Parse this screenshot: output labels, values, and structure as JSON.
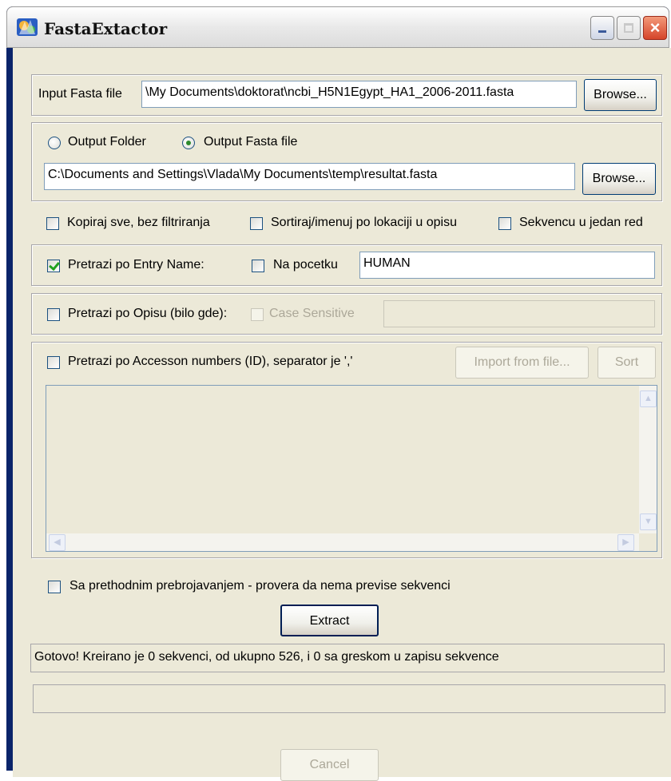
{
  "window": {
    "title": "FastaExtactor",
    "icon": "app-icon"
  },
  "input": {
    "label": "Input Fasta file",
    "value": "\\My Documents\\doktorat\\ncbi_H5N1Egypt_HA1_2006-2011.fasta",
    "browse_label": "Browse..."
  },
  "output": {
    "radio_folder_label": "Output Folder",
    "radio_file_label": "Output Fasta file",
    "selected": "Output Fasta file",
    "value": "C:\\Documents and Settings\\Vlada\\My Documents\\temp\\resultat.fasta",
    "browse_label": "Browse..."
  },
  "options": {
    "copy_all_label": "Kopiraj sve, bez filtriranja",
    "sort_label": "Sortiraj/imenuj po lokaciji u opisu",
    "one_line_label": "Sekvencu u jedan red"
  },
  "entry_name": {
    "label": "Pretrazi po Entry Name:",
    "checked": true,
    "at_start_label": "Na pocetku",
    "value": "HUMAN"
  },
  "description": {
    "label": "Pretrazi po Opisu (bilo gde):",
    "case_label": "Case Sensitive",
    "value": ""
  },
  "accession": {
    "label": "Pretrazi po Accesson numbers (ID), separator je ','",
    "import_label": "Import from file...",
    "sort_label": "Sort"
  },
  "precount": {
    "label": "Sa prethodnim prebrojavanjem - provera da nema previse sekvenci"
  },
  "extract_label": "Extract",
  "status_text": "Gotovo! Kreirano je 0 sekvenci, od ukupno 526, i 0 sa greskom u zapisu sekvence",
  "progress_value": 0,
  "cancel_label": "Cancel"
}
